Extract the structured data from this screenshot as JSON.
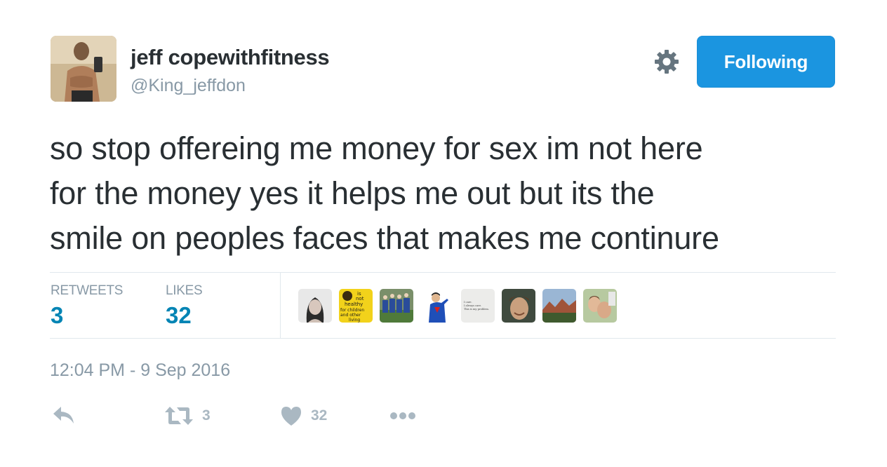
{
  "user": {
    "display_name": "jeff copewithfitness",
    "handle": "@King_jeffdon"
  },
  "follow_button": {
    "label": "Following"
  },
  "tweet": {
    "lines": [
      "so stop offereing me money for sex im not here",
      "for the money yes it helps me out but its the",
      "smile on peoples faces that makes me continure"
    ],
    "timestamp": "12:04 PM - 9 Sep 2016"
  },
  "stats": {
    "retweets_label": "RETWEETS",
    "retweets_count": "3",
    "likes_label": "LIKES",
    "likes_count": "32"
  },
  "likers": [
    {
      "icon": "woman-portrait"
    },
    {
      "icon": "yellow-poster",
      "text": [
        "is",
        "not",
        "healthy",
        "for children",
        "and other",
        "living"
      ]
    },
    {
      "icon": "sports-team"
    },
    {
      "icon": "superman-costume"
    },
    {
      "icon": "text-note",
      "text": [
        "I care.",
        "I always care.",
        "This is my problem."
      ]
    },
    {
      "icon": "man-selfie"
    },
    {
      "icon": "landscape"
    },
    {
      "icon": "group-selfie"
    }
  ],
  "actions": {
    "reply": {
      "icon": "reply-icon"
    },
    "retweet": {
      "icon": "retweet-icon",
      "count": "3"
    },
    "like": {
      "icon": "heart-icon",
      "count": "32"
    },
    "more": {
      "icon": "more-icon"
    }
  },
  "colors": {
    "accent": "#1b95e0",
    "stat_value": "#0084b4",
    "muted": "#8899a6",
    "icon_muted": "#aab8c2",
    "text": "#292f33"
  }
}
